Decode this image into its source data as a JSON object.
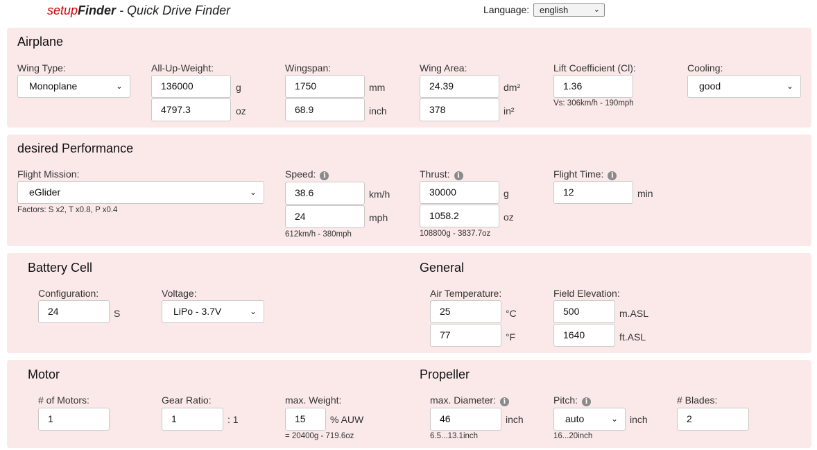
{
  "header": {
    "brand_prefix": "setup",
    "brand_suffix": "Finder",
    "subtitle": " - Quick Drive Finder",
    "language_label": "Language:",
    "language_value": "english"
  },
  "airplane": {
    "title": "Airplane",
    "wing_type": {
      "label": "Wing Type:",
      "value": "Monoplane"
    },
    "auw": {
      "label": "All-Up-Weight:",
      "value_g": "136000",
      "unit_g": "g",
      "value_oz": "4797.3",
      "unit_oz": "oz"
    },
    "wingspan": {
      "label": "Wingspan:",
      "value_mm": "1750",
      "unit_mm": "mm",
      "value_inch": "68.9",
      "unit_inch": "inch"
    },
    "wing_area": {
      "label": "Wing Area:",
      "value_dm2": "24.39",
      "unit_dm2": "dm²",
      "value_in2": "378",
      "unit_in2": "in²"
    },
    "lift": {
      "label": "Lift Coefficient (Cl):",
      "value": "1.36",
      "hint": "Vs: 306km/h - 190mph"
    },
    "cooling": {
      "label": "Cooling:",
      "value": "good"
    }
  },
  "performance": {
    "title": "desired Performance",
    "mission": {
      "label": "Flight Mission:",
      "value": "eGlider",
      "hint": "Factors: S x2, T x0.8, P x0.4"
    },
    "speed": {
      "label": "Speed:",
      "value_kmh": "38.6",
      "unit_kmh": "km/h",
      "value_mph": "24",
      "unit_mph": "mph",
      "hint": "612km/h - 380mph"
    },
    "thrust": {
      "label": "Thrust:",
      "value_g": "30000",
      "unit_g": "g",
      "value_oz": "1058.2",
      "unit_oz": "oz",
      "hint": "108800g - 3837.7oz"
    },
    "flight_time": {
      "label": "Flight Time:",
      "value": "12",
      "unit": "min"
    }
  },
  "battery": {
    "title": "Battery Cell",
    "configuration": {
      "label": "Configuration:",
      "value": "24",
      "unit": "S"
    },
    "voltage": {
      "label": "Voltage:",
      "value": "LiPo - 3.7V"
    }
  },
  "general": {
    "title": "General",
    "air_temp": {
      "label": "Air Temperature:",
      "value_c": "25",
      "unit_c": "°C",
      "value_f": "77",
      "unit_f": "°F"
    },
    "elevation": {
      "label": "Field Elevation:",
      "value_m": "500",
      "unit_m": "m.ASL",
      "value_ft": "1640",
      "unit_ft": "ft.ASL"
    }
  },
  "motor": {
    "title": "Motor",
    "count": {
      "label": "# of Motors:",
      "value": "1"
    },
    "gear": {
      "label": "Gear Ratio:",
      "value": "1",
      "unit": ": 1"
    },
    "max_weight": {
      "label": "max. Weight:",
      "value": "15",
      "unit": "% AUW",
      "hint": "= 20400g - 719.6oz"
    }
  },
  "propeller": {
    "title": "Propeller",
    "diameter": {
      "label": "max. Diameter:",
      "value": "46",
      "unit": "inch",
      "hint": "6.5...13.1inch"
    },
    "pitch": {
      "label": "Pitch:",
      "value": "auto",
      "unit": "inch",
      "hint": "16...20inch"
    },
    "blades": {
      "label": "# Blades:",
      "value": "2"
    }
  },
  "icons": {
    "info": "info-icon",
    "chevron": "chevron-down-icon"
  }
}
